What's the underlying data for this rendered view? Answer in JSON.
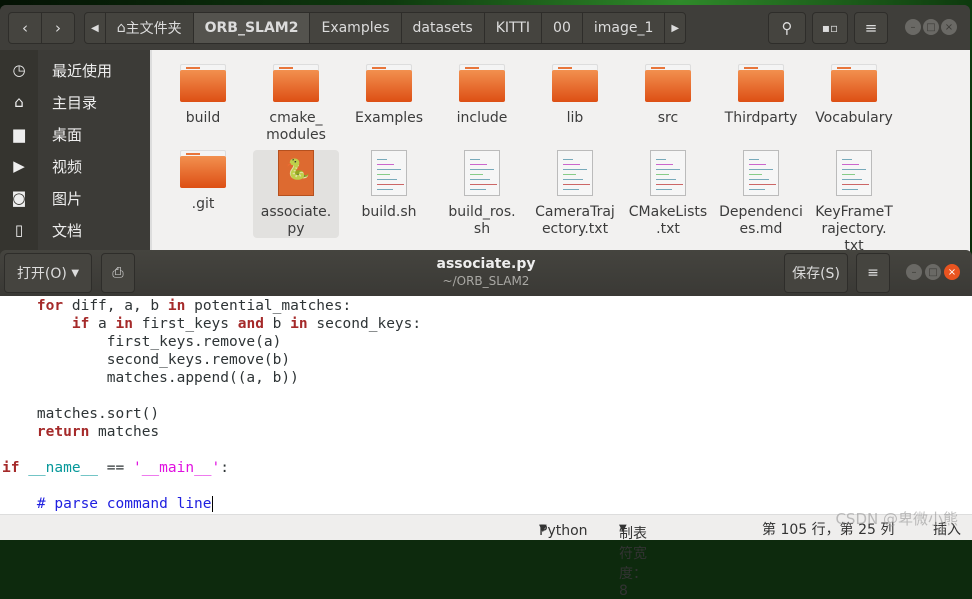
{
  "file_manager": {
    "nav": {
      "back_icon": "‹",
      "forward_icon": "›"
    },
    "breadcrumbs": [
      "主文件夹",
      "ORB_SLAM2",
      "Examples",
      "datasets",
      "KITTI",
      "00",
      "image_1"
    ],
    "active_crumb": "ORB_SLAM2",
    "sidebar": [
      {
        "icon": "clock-icon",
        "glyph": "◷",
        "label": "最近使用"
      },
      {
        "icon": "home-icon",
        "glyph": "⌂",
        "label": "主目录"
      },
      {
        "icon": "desktop-folder-icon",
        "glyph": "▆",
        "label": "桌面"
      },
      {
        "icon": "video-icon",
        "glyph": "▶",
        "label": "视频"
      },
      {
        "icon": "camera-icon",
        "glyph": "◙",
        "label": "图片"
      },
      {
        "icon": "document-icon",
        "glyph": "▯",
        "label": "文档"
      }
    ],
    "files": [
      {
        "name": "build",
        "kind": "folder"
      },
      {
        "name": "cmake_\nmodules",
        "kind": "folder"
      },
      {
        "name": "Examples",
        "kind": "folder"
      },
      {
        "name": "include",
        "kind": "folder"
      },
      {
        "name": "lib",
        "kind": "folder"
      },
      {
        "name": "src",
        "kind": "folder"
      },
      {
        "name": "Thirdparty",
        "kind": "folder"
      },
      {
        "name": "Vocabulary",
        "kind": "folder"
      },
      {
        "name": ".git",
        "kind": "folder"
      },
      {
        "name": "associate.\npy",
        "kind": "python",
        "selected": true
      },
      {
        "name": "build.sh",
        "kind": "text"
      },
      {
        "name": "build_ros.\nsh",
        "kind": "text"
      },
      {
        "name": "CameraTraj\nectory.txt",
        "kind": "text"
      },
      {
        "name": "CMakeLists\n.txt",
        "kind": "text"
      },
      {
        "name": "Dependenci\nes.md",
        "kind": "text"
      },
      {
        "name": "KeyFrameT\nrajectory.\ntxt",
        "kind": "text"
      }
    ]
  },
  "editor": {
    "open_label": "打开(O)",
    "title": "associate.py",
    "subtitle": "~/ORB_SLAM2",
    "save_label": "保存(S)",
    "code": [
      [
        [
          "    ",
          ""
        ],
        [
          "for",
          "kw"
        ],
        [
          " diff, a, b ",
          ""
        ],
        [
          "in",
          "kw"
        ],
        [
          " potential_matches:",
          ""
        ]
      ],
      [
        [
          "        ",
          ""
        ],
        [
          "if",
          "kw"
        ],
        [
          " a ",
          ""
        ],
        [
          "in",
          "kw"
        ],
        [
          " first_keys ",
          ""
        ],
        [
          "and",
          "kw"
        ],
        [
          " b ",
          ""
        ],
        [
          "in",
          "kw"
        ],
        [
          " second_keys:",
          ""
        ]
      ],
      [
        [
          "            first_keys.remove(a)",
          ""
        ]
      ],
      [
        [
          "            second_keys.remove(b)",
          ""
        ]
      ],
      [
        [
          "            matches.append((a, b))",
          ""
        ]
      ],
      [],
      [
        [
          "    matches.sort()",
          ""
        ]
      ],
      [
        [
          "    ",
          ""
        ],
        [
          "return",
          "kw"
        ],
        [
          " matches",
          ""
        ]
      ],
      [],
      [
        [
          "if",
          "kw"
        ],
        [
          " ",
          ""
        ],
        [
          "__name__",
          "bi"
        ],
        [
          " == ",
          ""
        ],
        [
          "'__main__'",
          "str"
        ],
        [
          ":",
          ""
        ]
      ],
      [],
      [
        [
          "    ",
          ""
        ],
        [
          "# parse command line",
          "cm"
        ]
      ]
    ],
    "status": {
      "language": "Python",
      "tab_width": "制表符宽度：8",
      "position": "第 105 行，第 25 列",
      "mode": "插入"
    }
  },
  "watermark": "CSDN @卑微小熊"
}
